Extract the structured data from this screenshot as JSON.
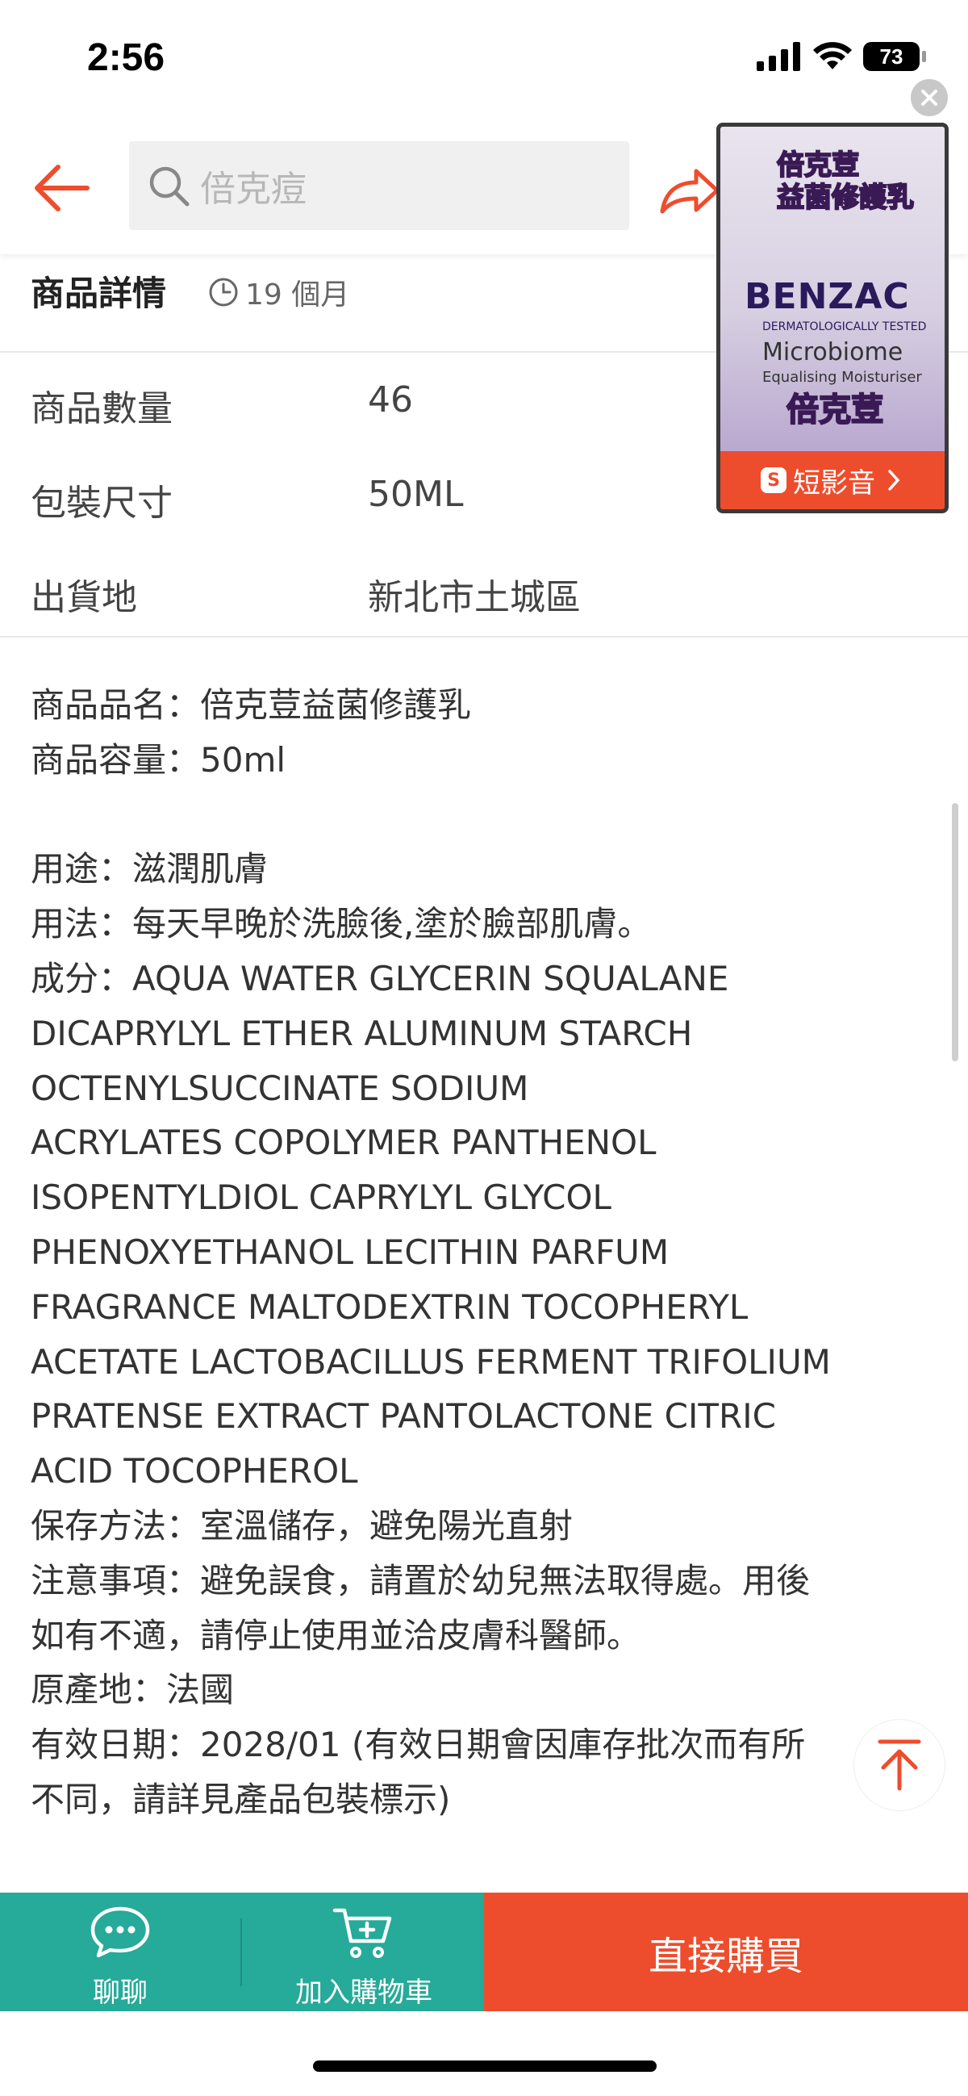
{
  "status_bar": {
    "time": "2:56",
    "battery": "73"
  },
  "header": {
    "search_placeholder": "倍克痘"
  },
  "section": {
    "title": "商品詳情",
    "age": "19 個月"
  },
  "specs": [
    {
      "label": "商品數量",
      "value": "46"
    },
    {
      "label": "包裝尺寸",
      "value": "50ML"
    },
    {
      "label": "出貨地",
      "value": "新北市土城區"
    }
  ],
  "description": {
    "lines": [
      "商品品名：倍克荳益菌修護乳",
      "商品容量：50ml",
      "",
      "用途：滋潤肌膚",
      "用法：每天早晚於洗臉後,塗於臉部肌膚。",
      "成分：AQUA WATER GLYCERIN SQUALANE",
      "DICAPRYLYL ETHER ALUMINUM STARCH",
      "OCTENYLSUCCINATE SODIUM",
      "ACRYLATES COPOLYMER PANTHENOL",
      "ISOPENTYLDIOL CAPRYLYL GLYCOL",
      "PHENOXYETHANOL LECITHIN PARFUM",
      "FRAGRANCE MALTODEXTRIN TOCOPHERYL",
      "ACETATE LACTOBACILLUS FERMENT TRIFOLIUM",
      "PRATENSE EXTRACT PANTOLACTONE CITRIC",
      "ACID TOCOPHEROL",
      "保存方法：室溫儲存，避免陽光直射",
      "注意事項：避免誤食，請置於幼兒無法取得處。用後",
      "如有不適，請停止使用並洽皮膚科醫師。",
      "原產地：法國",
      "有效日期：2028/01 (有效日期會因庫存批次而有所",
      "不同，請詳見產品包裝標示)"
    ]
  },
  "video_popup": {
    "caption_top": "倍克荳\n益菌修護乳",
    "brand": "BENZAC",
    "tagline": "DERMATOLOGICALLY TESTED",
    "product_name": "Microbiome",
    "product_desc": "Equalising Moisturiser",
    "caption_bottom": "倍克荳",
    "button_label": "短影音",
    "button_icon": "S"
  },
  "bottom_bar": {
    "chat_label": "聊聊",
    "cart_label": "加入購物車",
    "buy_label": "直接購買"
  },
  "colors": {
    "accent": "#ee4d2d",
    "teal": "#26aa99"
  }
}
